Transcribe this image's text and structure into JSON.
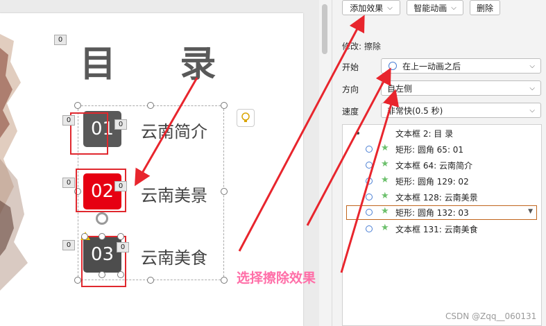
{
  "toolbar": {
    "add_effect": "添加效果",
    "smart_anim": "智能动画",
    "delete": "删除"
  },
  "panel": {
    "modify_title": "修改: 擦除",
    "start_label": "开始",
    "start_value": "在上一动画之后",
    "direction_label": "方向",
    "direction_value": "自左侧",
    "speed_label": "速度",
    "speed_value": "非常快(0.5 秒)"
  },
  "anim_list": [
    {
      "text": "文本框 2: 目 录"
    },
    {
      "text": "矩形: 圆角 65: 01"
    },
    {
      "text": "文本框 64: 云南简介"
    },
    {
      "text": "矩形: 圆角 129: 02"
    },
    {
      "text": "文本框 128: 云南美景"
    },
    {
      "text": "矩形: 圆角 132: 03"
    },
    {
      "text": "文本框 131: 云南美食"
    }
  ],
  "slide": {
    "title": "目    录",
    "items": [
      {
        "num": "01",
        "label": "云南简介",
        "color": "#595959"
      },
      {
        "num": "02",
        "label": "云南美景",
        "color": "#e60012"
      },
      {
        "num": "03",
        "label": "云南美食",
        "color": "#4d4d4d"
      }
    ],
    "tags": [
      "0",
      "0",
      "0",
      "0",
      "0",
      "0",
      "0"
    ]
  },
  "annotation": "选择擦除效果",
  "watermark": "CSDN @Zqq__060131",
  "colors": {
    "arrow": "#e8252d",
    "annotation": "#ff6fa8",
    "selected_border": "#c0651c"
  }
}
